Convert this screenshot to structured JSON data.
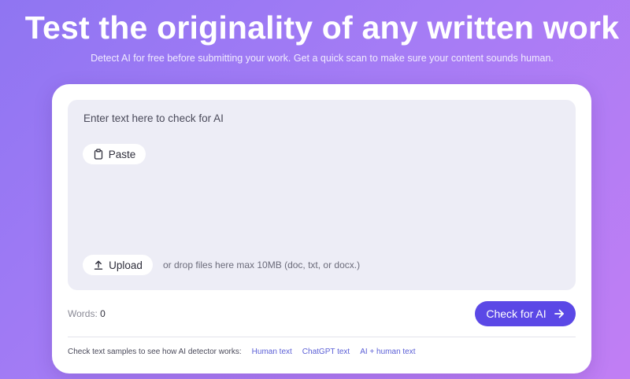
{
  "hero": {
    "title": "Test the originality of any written work",
    "subtitle": "Detect AI for free before submitting your work. Get a quick scan to make sure your content sounds human."
  },
  "editor": {
    "placeholder": "Enter text here to check for AI",
    "paste_label": "Paste",
    "paste_icon": "clipboard-icon",
    "upload_label": "Upload",
    "upload_icon": "upload-icon",
    "drop_hint": "or drop files here max 10MB (doc, txt, or docx.)"
  },
  "footer": {
    "words_label": "Words:",
    "words_count": "0",
    "check_label": "Check for AI",
    "check_icon": "arrow-right-icon",
    "samples_label": "Check text samples to see how AI detector works:",
    "samples": [
      "Human text",
      "ChatGPT text",
      "AI + human text"
    ]
  },
  "colors": {
    "accent": "#5b48e6",
    "link": "#5b5fd6",
    "editor_bg": "#ededf6"
  }
}
